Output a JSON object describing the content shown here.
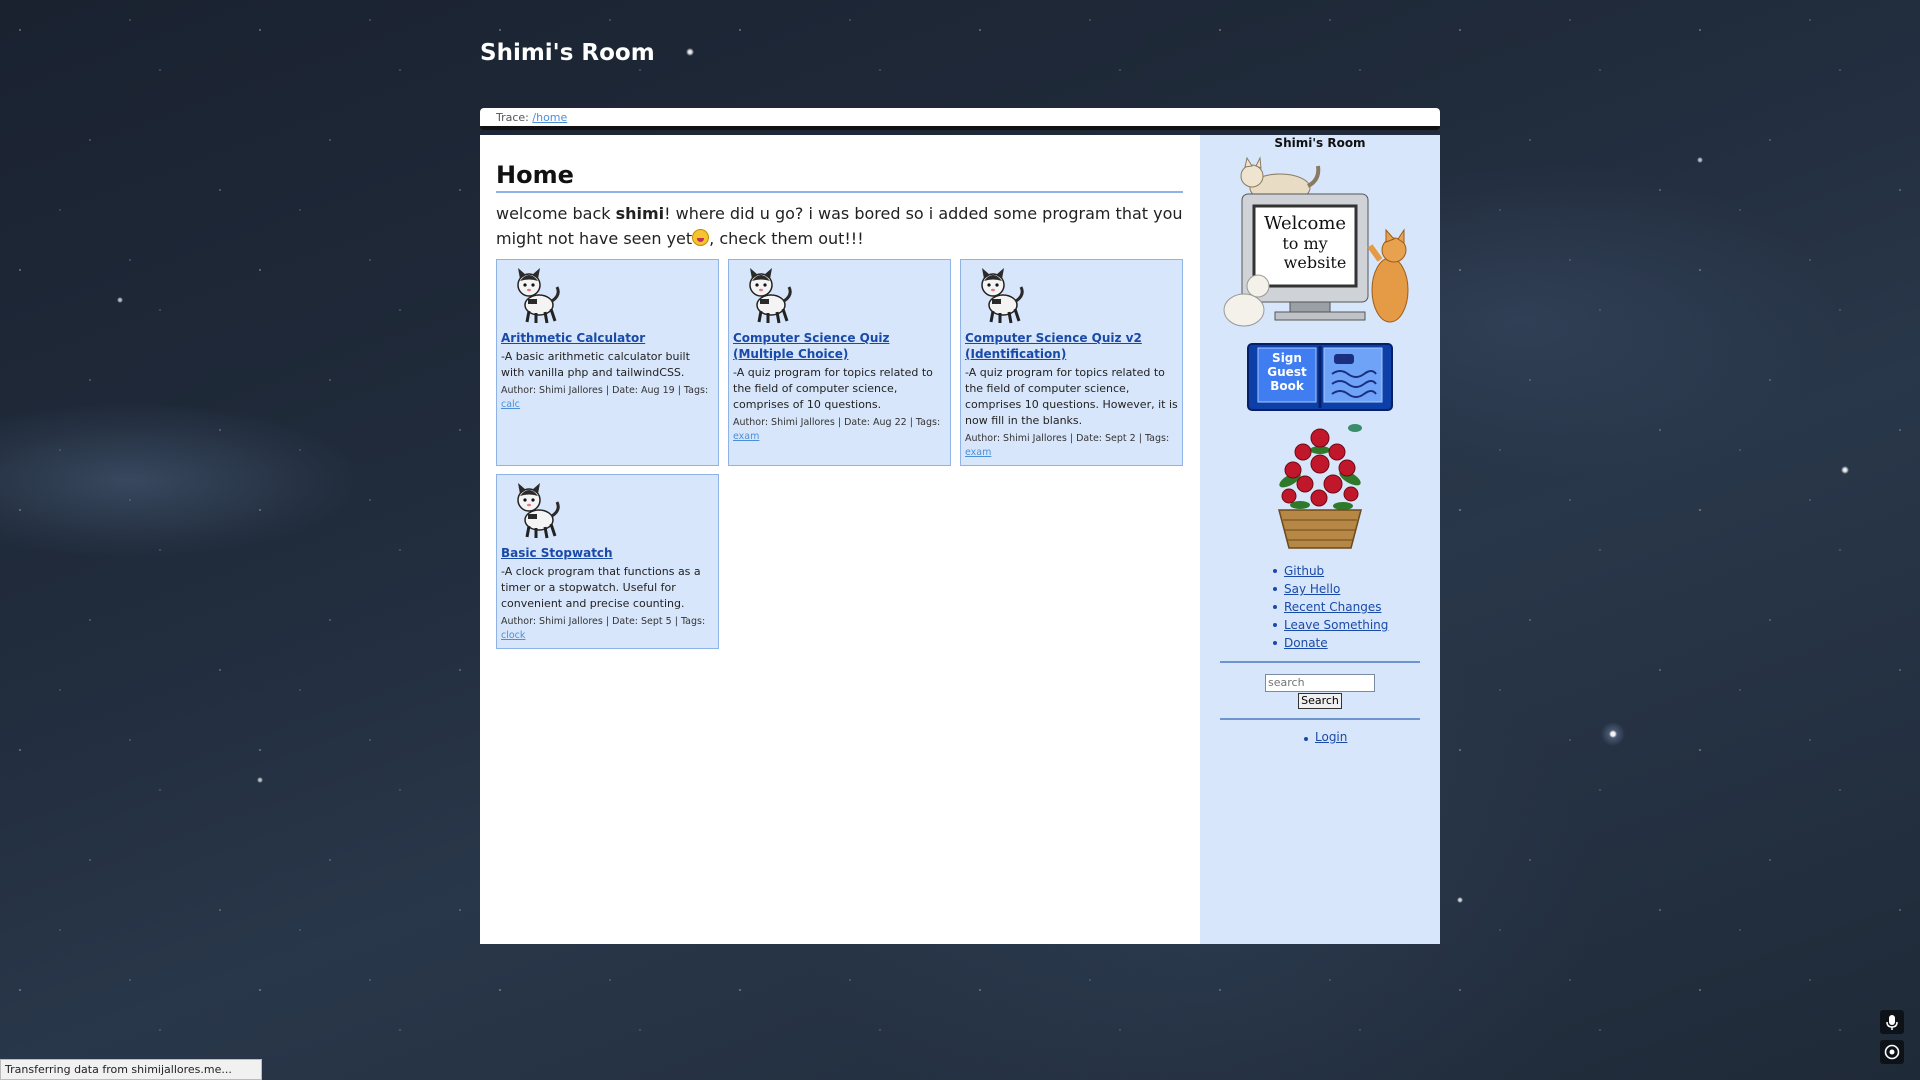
{
  "site": {
    "title": "Shimi's Room"
  },
  "trace": {
    "label": "Trace: ",
    "path": "/home"
  },
  "main": {
    "title": "Home",
    "welcome_before": "welcome back ",
    "welcome_user": "shimi",
    "welcome_after": "! where did u go? i was bored so i added some program that you might not have seen yet",
    "welcome_end": ", check them out!!!"
  },
  "cards": [
    {
      "title": "Arithmetic Calculator",
      "description": "-A basic arithmetic calculator built with vanilla php and tailwindCSS.",
      "meta": "Author: Shimi Jallores | Date: Aug 19 | Tags: ",
      "tag": "calc"
    },
    {
      "title": "Computer Science Quiz (Multiple Choice)",
      "description": "-A quiz program for topics related to the field of computer science, comprises of 10 questions.",
      "meta": "Author: Shimi Jallores | Date: Aug 22 | Tags: ",
      "tag": "exam"
    },
    {
      "title": "Computer Science Quiz v2 (Identification)",
      "description": "-A quiz program for topics related to the field of computer science, comprises 10 questions. However, it is now fill in the blanks.",
      "meta": "Author: Shimi Jallores | Date: Sept 2 | Tags: ",
      "tag": "exam"
    },
    {
      "title": "Basic Stopwatch",
      "description": "-A clock program that functions as a timer or a stopwatch. Useful for convenient and precise counting.",
      "meta": "Author: Shimi Jallores | Date: Sept 5 | Tags: ",
      "tag": "clock"
    }
  ],
  "sidebar": {
    "title": "Shimi's Room",
    "welcome_sign": [
      "Welcome",
      "to my",
      "website"
    ],
    "guestbook_sign": [
      "Sign",
      "Guest",
      "Book"
    ],
    "links": [
      "Github",
      "Say Hello",
      "Recent Changes",
      "Leave Something",
      "Donate"
    ],
    "search_placeholder": "search",
    "search_button": "Search",
    "login": "Login"
  },
  "status_bar": {
    "text": "Transferring data from shimijallores.me..."
  },
  "colors": {
    "panel_blue": "#d8e6fb",
    "border_blue": "#8fb3e6",
    "link_blue": "#1a4aa8"
  },
  "icons": [
    "kitten-icon",
    "welcome-cats-image",
    "guestbook-icon",
    "flower-basket-image",
    "mic-icon",
    "target-icon"
  ]
}
